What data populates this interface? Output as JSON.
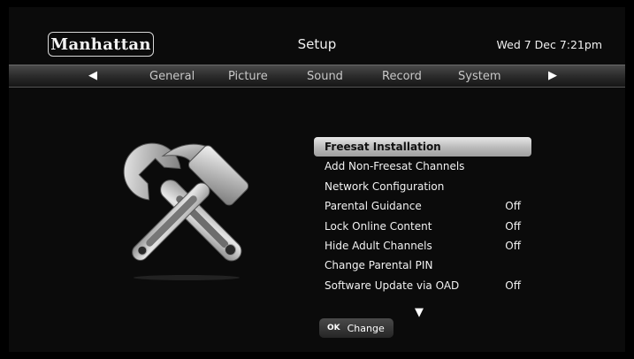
{
  "header": {
    "brand": "Manhattan",
    "title": "Setup",
    "datetime": "Wed 7 Dec 7:21pm"
  },
  "tabs": {
    "left_arrow": "◀",
    "right_arrow": "▶",
    "items": [
      "General",
      "Picture",
      "Sound",
      "Record",
      "System"
    ]
  },
  "menu": {
    "items": [
      {
        "label": "Freesat Installation",
        "value": "",
        "selected": true
      },
      {
        "label": "Add Non-Freesat Channels",
        "value": ""
      },
      {
        "label": "Network Configuration",
        "value": ""
      },
      {
        "label": "Parental Guidance",
        "value": "Off"
      },
      {
        "label": "Lock Online Content",
        "value": "Off"
      },
      {
        "label": "Hide Adult Channels",
        "value": "Off"
      },
      {
        "label": "Change Parental PIN",
        "value": ""
      },
      {
        "label": "Software Update via OAD",
        "value": "Off"
      }
    ],
    "scroll_arrow": "▼"
  },
  "footer": {
    "ok_key": "OK",
    "ok_label": "Change"
  },
  "icons": {
    "illustration": "hammer-and-wrench-icon"
  },
  "colors": {
    "background": "#0b0b0b",
    "highlight": "#c8c8c8"
  }
}
